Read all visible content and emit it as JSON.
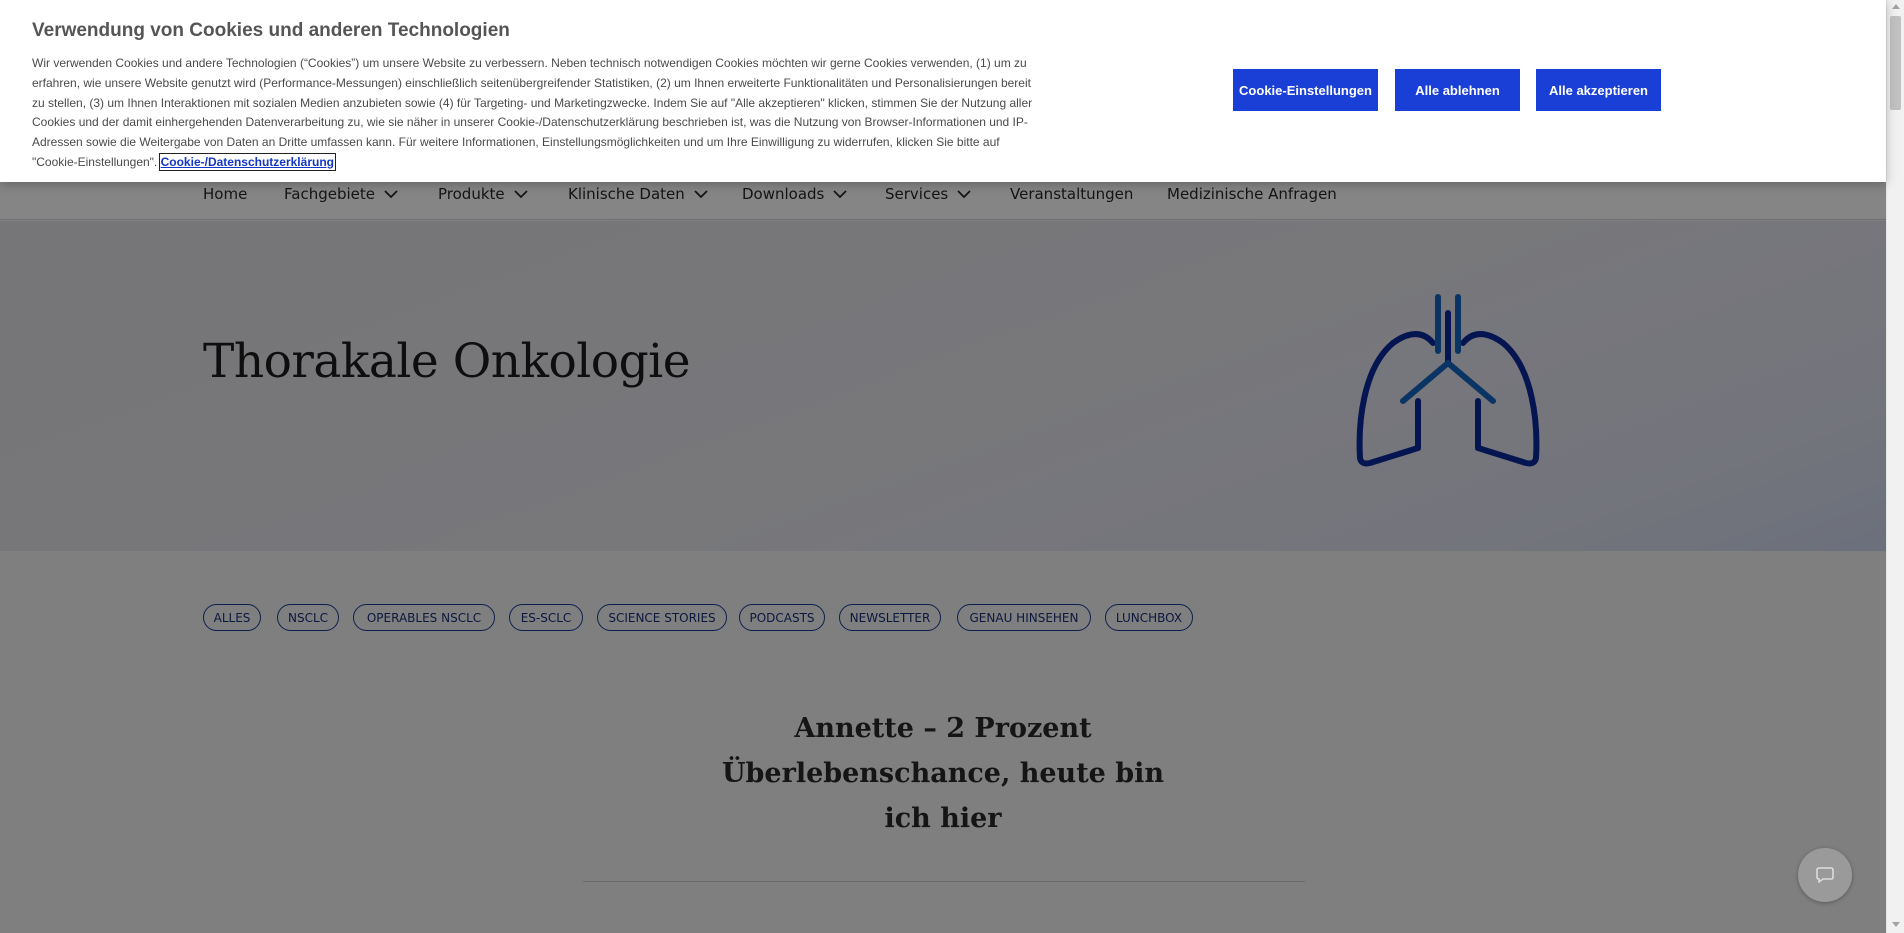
{
  "cookie_banner": {
    "title": "Verwendung von Cookies und anderen Technologien",
    "text": "Wir verwenden Cookies und andere Technologien (“Cookies”) um unsere Website zu verbessern. Neben technisch notwendigen Cookies möchten wir gerne Cookies verwenden, (1) um zu erfahren, wie unsere Website genutzt wird (Performance-Messungen) einschließlich seitenübergreifender Statistiken, (2) um Ihnen erweiterte Funktionalitäten und Personalisierungen bereit zu stellen, (3) um Ihnen Interaktionen mit sozialen Medien anzubieten sowie (4) für Targeting- und Marketingzwecke. Indem Sie auf \"Alle akzeptieren\" klicken, stimmen Sie der Nutzung aller Cookies und der damit einhergehenden Datenverarbeitung zu, wie sie näher in unserer Cookie-/Datenschutzerklärung beschrieben ist, was die Nutzung von Browser-Informationen und IP-Adressen sowie die Weitergabe von Daten an Dritte umfassen kann. Für weitere Informationen, Einstellungsmöglichkeiten und um Ihre Einwilligung zu widerrufen, klicken Sie bitte auf \"Cookie-Einstellungen\".",
    "link_label": "Cookie-/Datenschutzerklärung",
    "buttons": {
      "settings": "Cookie-Einstellungen",
      "reject_all": "Alle ablehnen",
      "accept_all": "Alle akzeptieren"
    },
    "button_color": "#1a3fd6"
  },
  "nav": {
    "items": [
      {
        "label": "Home",
        "has_dropdown": false
      },
      {
        "label": "Fachgebiete",
        "has_dropdown": true
      },
      {
        "label": "Produkte",
        "has_dropdown": true
      },
      {
        "label": "Klinische Daten",
        "has_dropdown": true
      },
      {
        "label": "Downloads",
        "has_dropdown": true
      },
      {
        "label": "Services",
        "has_dropdown": true
      },
      {
        "label": "Veranstaltungen",
        "has_dropdown": false
      },
      {
        "label": "Medizinische Anfragen",
        "has_dropdown": false
      }
    ]
  },
  "hero": {
    "title": "Thorakale Onkologie",
    "icon": "lungs-icon",
    "icon_colors": [
      "#0a2a9e",
      "#1565c0"
    ]
  },
  "filters": {
    "chips": [
      "ALLES",
      "NSCLC",
      "OPERABLES NSCLC",
      "ES-SCLC",
      "SCIENCE STORIES",
      "PODCASTS",
      "NEWSLETTER",
      "GENAU HINSEHEN",
      "LUNCHBOX"
    ],
    "color": "#1a3a8f"
  },
  "article": {
    "title": "Annette – 2 Prozent Überlebenschance, heute bin ich hier"
  },
  "chat": {
    "icon": "chat-icon"
  }
}
